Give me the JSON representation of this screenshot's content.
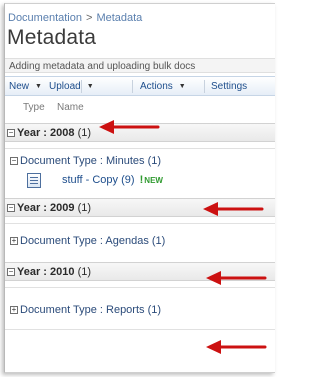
{
  "breadcrumb": {
    "root": "Documentation",
    "separator": ">",
    "current": "Metadata"
  },
  "page_title": "Metadata",
  "description": "Adding metadata and uploading bulk docs",
  "toolbar": {
    "new": "New",
    "upload": "Upload",
    "actions": "Actions",
    "settings": "Settings"
  },
  "columns": {
    "type": "Type",
    "name": "Name"
  },
  "groups": [
    {
      "label": "Year : 2008",
      "count": "(1)",
      "toggle": "−"
    },
    {
      "label": "Year : 2009",
      "count": "(1)",
      "toggle": "−"
    },
    {
      "label": "Year : 2010",
      "count": "(1)",
      "toggle": "−"
    }
  ],
  "subgroups": [
    {
      "label": "Document Type : Minutes",
      "count": "(1)",
      "toggle": "−"
    },
    {
      "label": "Document Type : Agendas",
      "count": "(1)",
      "toggle": "+"
    },
    {
      "label": "Document Type : Reports",
      "count": "(1)",
      "toggle": "+"
    }
  ],
  "item": {
    "name": "stuff - Copy",
    "count": "(9)",
    "new_mark": "!",
    "new_text": "NEW",
    "icon": "word-document-icon"
  },
  "colors": {
    "arrow": "#cc1111",
    "link": "#1e4e8c",
    "new": "#2f9a2f"
  }
}
